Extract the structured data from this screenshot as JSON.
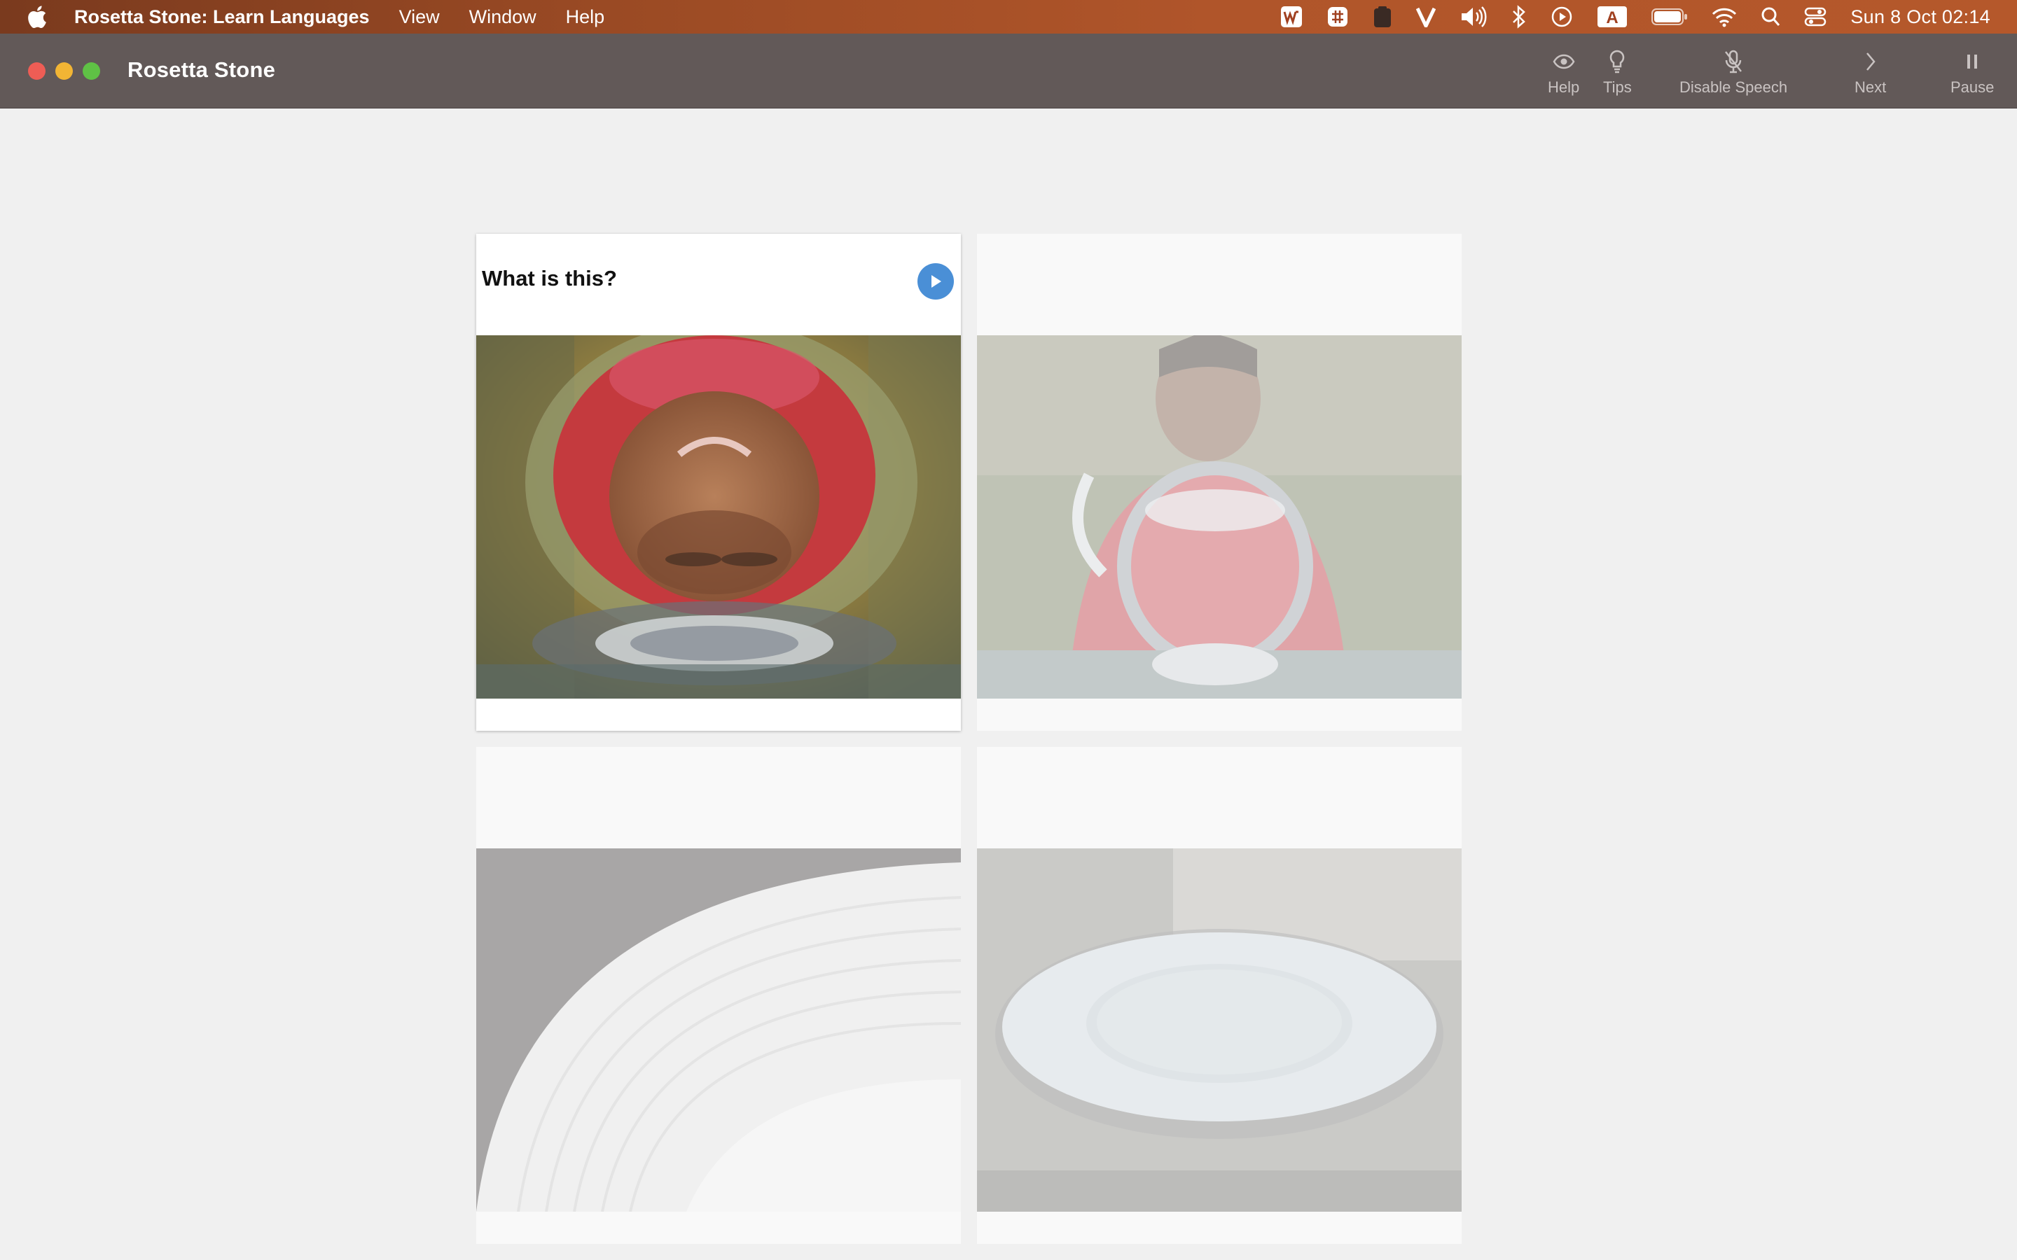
{
  "menubar": {
    "app_name": "Rosetta Stone: Learn Languages",
    "items": [
      "View",
      "Window",
      "Help"
    ],
    "clock": "Sun 8 Oct  02:14",
    "status_icons": [
      "wps-icon",
      "globe-grid-icon",
      "clipboard-icon",
      "v-icon",
      "volume-icon",
      "bluetooth-icon",
      "play-circle-icon",
      "keyboard-a-icon",
      "battery-icon",
      "wifi-icon",
      "search-icon",
      "control-center-icon"
    ]
  },
  "window": {
    "title": "Rosetta Stone",
    "toolbar": {
      "help": "Help",
      "tips": "Tips",
      "disable_speech": "Disable Speech",
      "next": "Next",
      "pause": "Pause"
    }
  },
  "lesson": {
    "prompt": "What is this?",
    "cards": [
      {
        "name": "card-glass-closeup",
        "subject": "child face through glass jug",
        "active": true
      },
      {
        "name": "card-boy-jug",
        "subject": "boy behind glass water jug",
        "active": false
      },
      {
        "name": "card-plate-closeup",
        "subject": "white plate rim close-up",
        "active": false
      },
      {
        "name": "card-plate",
        "subject": "white plate on table",
        "active": false
      }
    ]
  },
  "colors": {
    "accent_play": "#4a8fd6",
    "titlebar": "#625958",
    "content_bg": "#f0f0f0"
  }
}
